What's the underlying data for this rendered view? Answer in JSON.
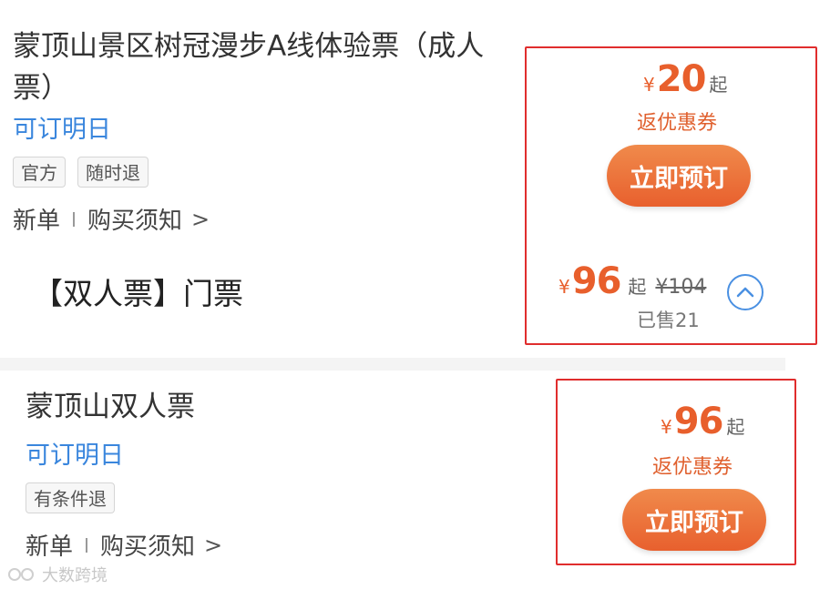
{
  "product1": {
    "title_line1": "蒙顶山景区树冠漫步A线体验票（成人",
    "title_line2": "票）",
    "availability": "可订明日",
    "tags": [
      "官方",
      "随时退"
    ],
    "meta_new": "新单",
    "meta_notice": "购买须知",
    "meta_chevron": ">",
    "price_currency": "¥",
    "price_value": "20",
    "price_suffix": "起",
    "coupon": "返优惠券",
    "book_label": "立即预订"
  },
  "subgroup": {
    "title": "【双人票】门票",
    "price_currency": "¥",
    "price_value": "96",
    "price_suffix": "起",
    "original_price": "¥104",
    "sold": "已售21"
  },
  "product2": {
    "title": "蒙顶山双人票",
    "availability": "可订明日",
    "tags": [
      "有条件退"
    ],
    "meta_new": "新单",
    "meta_notice": "购买须知",
    "meta_chevron": ">",
    "price_currency": "¥",
    "price_value": "96",
    "price_suffix": "起",
    "coupon": "返优惠券",
    "book_label": "立即预订"
  },
  "watermark": {
    "text": "大数跨境"
  },
  "colors": {
    "accent_orange": "#e85f2c",
    "link_blue": "#3a86dd",
    "highlight_red": "#e02d2d"
  }
}
